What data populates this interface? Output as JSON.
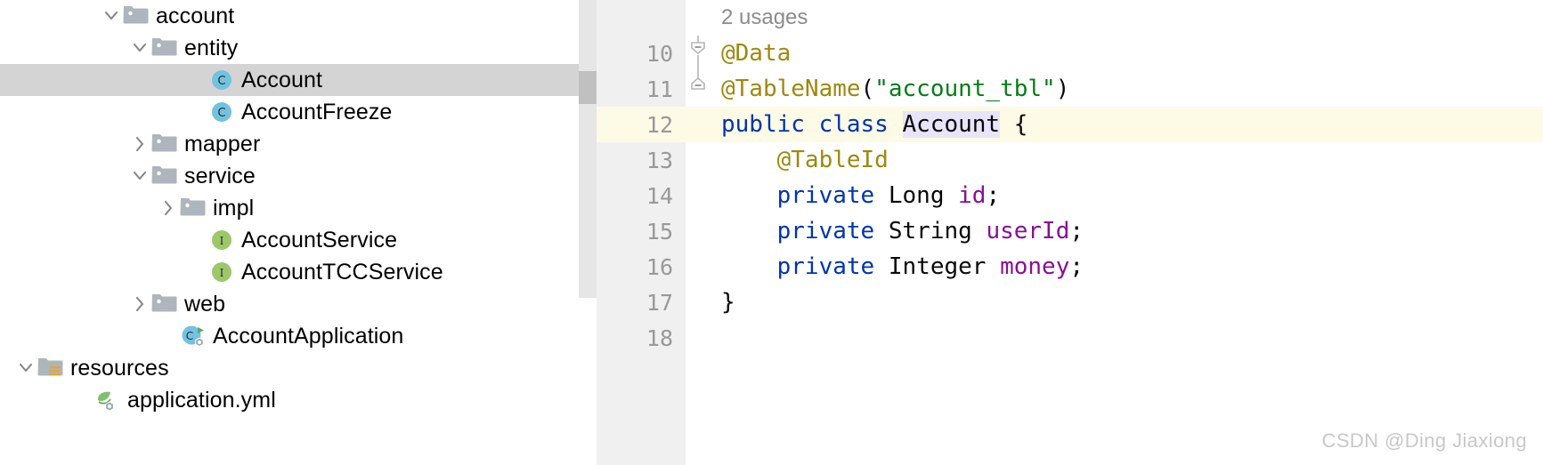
{
  "tree": {
    "rows": [
      {
        "indent": 112,
        "twisty": "chevron-down-icon",
        "icon": "folder-icon",
        "label": "account",
        "selected": false
      },
      {
        "indent": 144,
        "twisty": "chevron-down-icon",
        "icon": "folder-icon",
        "label": "entity",
        "selected": false
      },
      {
        "indent": 208,
        "twisty": "none",
        "icon": "java-class-icon",
        "label": "Account",
        "selected": true
      },
      {
        "indent": 208,
        "twisty": "none",
        "icon": "java-class-icon",
        "label": "AccountFreeze",
        "selected": false
      },
      {
        "indent": 144,
        "twisty": "chevron-right-icon",
        "icon": "folder-icon",
        "label": "mapper",
        "selected": false
      },
      {
        "indent": 144,
        "twisty": "chevron-down-icon",
        "icon": "folder-icon",
        "label": "service",
        "selected": false
      },
      {
        "indent": 176,
        "twisty": "chevron-right-icon",
        "icon": "folder-icon",
        "label": "impl",
        "selected": false
      },
      {
        "indent": 208,
        "twisty": "none",
        "icon": "java-interface-icon",
        "label": "AccountService",
        "selected": false
      },
      {
        "indent": 208,
        "twisty": "none",
        "icon": "java-interface-icon",
        "label": "AccountTCCService",
        "selected": false
      },
      {
        "indent": 144,
        "twisty": "chevron-right-icon",
        "icon": "folder-icon",
        "label": "web",
        "selected": false
      },
      {
        "indent": 176,
        "twisty": "none",
        "icon": "spring-boot-class-icon",
        "label": "AccountApplication",
        "selected": false
      },
      {
        "indent": 16,
        "twisty": "chevron-down-icon",
        "icon": "resources-folder-icon",
        "label": "resources",
        "selected": false
      },
      {
        "indent": 80,
        "twisty": "none",
        "icon": "spring-yaml-icon",
        "label": "application.yml",
        "selected": false
      }
    ]
  },
  "editor": {
    "usages_hint": "2 usages",
    "lines": [
      {
        "number": "10",
        "fold": "fold-minus-start",
        "current": false,
        "tokens": [
          {
            "t": "@Data",
            "c": "t-ann"
          }
        ]
      },
      {
        "number": "11",
        "fold": "fold-minus-end",
        "current": false,
        "tokens": [
          {
            "t": "@TableName",
            "c": "t-ann"
          },
          {
            "t": "(",
            "c": "t-plain"
          },
          {
            "t": "\"account_tbl\"",
            "c": "t-str"
          },
          {
            "t": ")",
            "c": "t-plain"
          }
        ]
      },
      {
        "number": "12",
        "fold": "none",
        "current": true,
        "tokens": [
          {
            "t": "public class ",
            "c": "t-kw"
          },
          {
            "t": "Account",
            "c": "t-plain t-hl"
          },
          {
            "t": " {",
            "c": "t-plain"
          }
        ]
      },
      {
        "number": "13",
        "fold": "none",
        "current": false,
        "tokens": [
          {
            "t": "    @TableId",
            "c": "t-ann"
          }
        ]
      },
      {
        "number": "14",
        "fold": "none",
        "current": false,
        "tokens": [
          {
            "t": "    ",
            "c": "t-plain"
          },
          {
            "t": "private ",
            "c": "t-kw"
          },
          {
            "t": "Long ",
            "c": "t-plain"
          },
          {
            "t": "id",
            "c": "t-field"
          },
          {
            "t": ";",
            "c": "t-plain"
          }
        ]
      },
      {
        "number": "15",
        "fold": "none",
        "current": false,
        "tokens": [
          {
            "t": "    ",
            "c": "t-plain"
          },
          {
            "t": "private ",
            "c": "t-kw"
          },
          {
            "t": "String ",
            "c": "t-plain"
          },
          {
            "t": "userId",
            "c": "t-field"
          },
          {
            "t": ";",
            "c": "t-plain"
          }
        ]
      },
      {
        "number": "16",
        "fold": "none",
        "current": false,
        "tokens": [
          {
            "t": "    ",
            "c": "t-plain"
          },
          {
            "t": "private ",
            "c": "t-kw"
          },
          {
            "t": "Integer ",
            "c": "t-plain"
          },
          {
            "t": "money",
            "c": "t-field"
          },
          {
            "t": ";",
            "c": "t-plain"
          }
        ]
      },
      {
        "number": "17",
        "fold": "none",
        "current": false,
        "tokens": [
          {
            "t": "}",
            "c": "t-plain"
          }
        ]
      },
      {
        "number": "18",
        "fold": "none",
        "current": false,
        "tokens": []
      }
    ]
  },
  "watermark": {
    "text": "CSDN @Ding Jiaxiong"
  },
  "colors": {
    "selection": "#d4d4d4",
    "current_line": "#fdfae6",
    "gutter": "#f0f0f0",
    "annotation": "#9e880d",
    "keyword": "#0033b3",
    "string": "#067d17",
    "field": "#871094",
    "identifier_highlight": "#e8e5fb",
    "folder": "#aeb6bd",
    "class_icon": "#72c2e0",
    "interface_icon": "#9cc86a",
    "watermark": "#c8c8c8"
  }
}
